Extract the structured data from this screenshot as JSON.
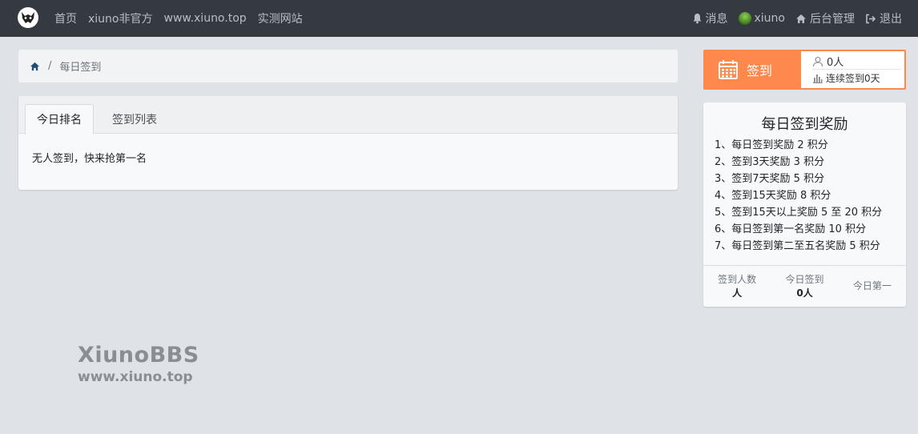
{
  "nav": {
    "links": [
      "首页",
      "xiuno非官方",
      "www.xiuno.top",
      "实测网站"
    ],
    "messages": "消息",
    "username": "xiuno",
    "admin": "后台管理",
    "logout": "退出"
  },
  "breadcrumb": {
    "separator": "/",
    "current": "每日签到"
  },
  "tabs": {
    "items": [
      "今日排名",
      "签到列表"
    ],
    "active": 0,
    "empty_text": "无人签到，快来抢第一名"
  },
  "sign": {
    "button_label": "签到",
    "count": "0人",
    "streak": "连续签到0天"
  },
  "reward": {
    "title": "每日签到奖励",
    "rules": [
      "1、每日签到奖励 2 积分",
      "2、签到3天奖励 3 积分",
      "3、签到7天奖励 5 积分",
      "4、签到15天奖励 8 积分",
      "5、签到15天以上奖励 5 至 20 积分",
      "6、每日签到第一名奖励 10 积分",
      "7、每日签到第二至五名奖励 5 积分"
    ],
    "stats": {
      "total_label": "签到人数",
      "total_value": "人",
      "today_label": "今日签到",
      "today_value": "0人",
      "first_label": "今日第一"
    }
  },
  "watermark": {
    "line1": "XiunoBBS",
    "line2": "www.xiuno.top"
  },
  "colors": {
    "navbar": "#343a40",
    "accent": "#ff884d",
    "background": "#dfe2e6"
  }
}
